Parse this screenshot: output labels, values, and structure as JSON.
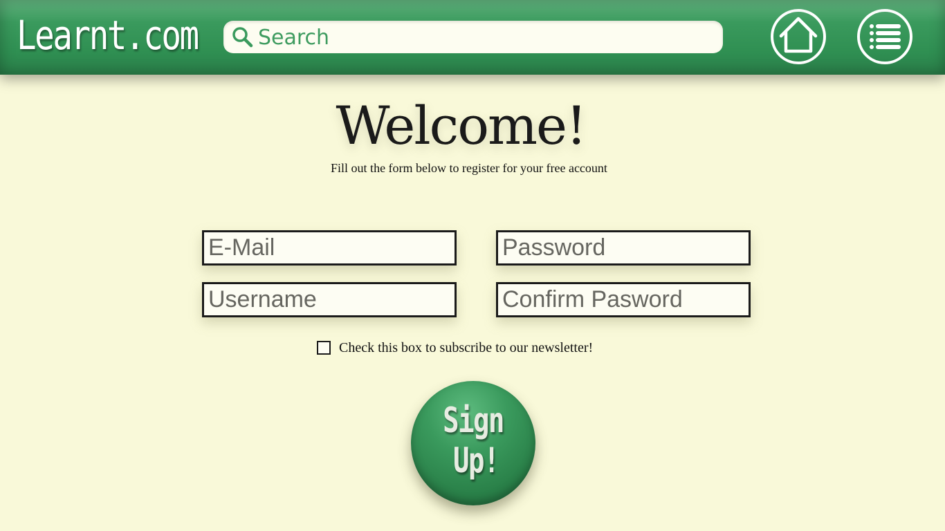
{
  "header": {
    "logo": "Learnt.com",
    "search": {
      "placeholder": "Search"
    },
    "nav": {
      "home_icon": "home-icon",
      "menu_icon": "list-menu-icon"
    }
  },
  "welcome": {
    "title": "Welcome!",
    "subtitle": "Fill out the form below to register for your free account"
  },
  "form": {
    "email_placeholder": "E-Mail",
    "password_placeholder": "Password",
    "username_placeholder": "Username",
    "confirm_password_placeholder": "Confirm Pasword",
    "newsletter_label": "Check this box to subscribe to our newsletter!",
    "newsletter_checked": false,
    "signup_line1": "Sign",
    "signup_line2": "Up!"
  },
  "colors": {
    "header_green": "#3a9a5d",
    "page_background": "#f9f9d9",
    "search_background": "#fdfdf1",
    "text_dark": "#1a1a1a"
  }
}
